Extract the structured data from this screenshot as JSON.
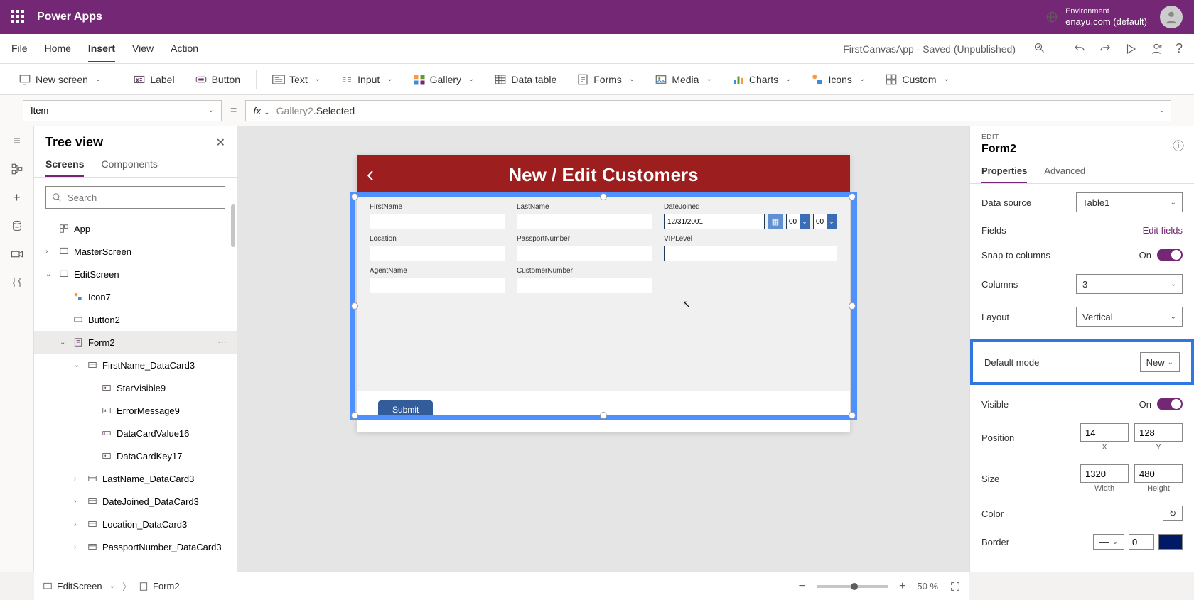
{
  "header": {
    "app_title": "Power Apps",
    "env_label": "Environment",
    "env_name": "enayu.com (default)"
  },
  "menu": {
    "items": [
      "File",
      "Home",
      "Insert",
      "View",
      "Action"
    ],
    "active": "Insert",
    "app_state": "FirstCanvasApp - Saved (Unpublished)"
  },
  "ribbon": {
    "new_screen": "New screen",
    "label": "Label",
    "button": "Button",
    "text": "Text",
    "input": "Input",
    "gallery": "Gallery",
    "data_table": "Data table",
    "forms": "Forms",
    "media": "Media",
    "charts": "Charts",
    "icons": "Icons",
    "custom": "Custom"
  },
  "formula": {
    "property": "Item",
    "fx": "fx",
    "expr_obj": "Gallery2",
    "expr_suffix": ".Selected"
  },
  "tree": {
    "title": "Tree view",
    "tabs": {
      "screens": "Screens",
      "components": "Components"
    },
    "search_placeholder": "Search",
    "nodes": [
      {
        "label": "App",
        "depth": 0,
        "caret": ""
      },
      {
        "label": "MasterScreen",
        "depth": 1,
        "caret": "›"
      },
      {
        "label": "EditScreen",
        "depth": 1,
        "caret": "⌄"
      },
      {
        "label": "Icon7",
        "depth": 2,
        "caret": ""
      },
      {
        "label": "Button2",
        "depth": 2,
        "caret": ""
      },
      {
        "label": "Form2",
        "depth": 2,
        "caret": "⌄",
        "selected": true
      },
      {
        "label": "FirstName_DataCard3",
        "depth": 3,
        "caret": "⌄"
      },
      {
        "label": "StarVisible9",
        "depth": 4,
        "caret": ""
      },
      {
        "label": "ErrorMessage9",
        "depth": 4,
        "caret": ""
      },
      {
        "label": "DataCardValue16",
        "depth": 4,
        "caret": ""
      },
      {
        "label": "DataCardKey17",
        "depth": 4,
        "caret": ""
      },
      {
        "label": "LastName_DataCard3",
        "depth": 3,
        "caret": "›"
      },
      {
        "label": "DateJoined_DataCard3",
        "depth": 3,
        "caret": "›"
      },
      {
        "label": "Location_DataCard3",
        "depth": 3,
        "caret": "›"
      },
      {
        "label": "PassportNumber_DataCard3",
        "depth": 3,
        "caret": "›"
      }
    ]
  },
  "canvas": {
    "screen_title": "New / Edit Customers",
    "fields": {
      "FirstName": "FirstName",
      "LastName": "LastName",
      "DateJoined": "DateJoined",
      "Location": "Location",
      "PassportNumber": "PassportNumber",
      "VIPLevel": "VIPLevel",
      "AgentName": "AgentName",
      "CustomerNumber": "CustomerNumber"
    },
    "date_value": "12/31/2001",
    "hour": "00",
    "minute": "00",
    "submit": "Submit"
  },
  "props": {
    "edit": "EDIT",
    "name": "Form2",
    "tabs": {
      "properties": "Properties",
      "advanced": "Advanced"
    },
    "data_source_l": "Data source",
    "data_source_v": "Table1",
    "fields_l": "Fields",
    "edit_fields": "Edit fields",
    "snap_l": "Snap to columns",
    "on": "On",
    "columns_l": "Columns",
    "columns_v": "3",
    "layout_l": "Layout",
    "layout_v": "Vertical",
    "default_mode_l": "Default mode",
    "default_mode_v": "New",
    "visible_l": "Visible",
    "position_l": "Position",
    "pos_x": "14",
    "pos_y": "128",
    "xl": "X",
    "yl": "Y",
    "size_l": "Size",
    "w": "1320",
    "h": "480",
    "wl": "Width",
    "hl": "Height",
    "color_l": "Color",
    "border_l": "Border",
    "border_v": "0",
    "line": "—"
  },
  "status": {
    "crumb1": "EditScreen",
    "crumb2": "Form2",
    "zoom": "50",
    "pct": "%",
    "minus": "−",
    "plus": "+"
  }
}
